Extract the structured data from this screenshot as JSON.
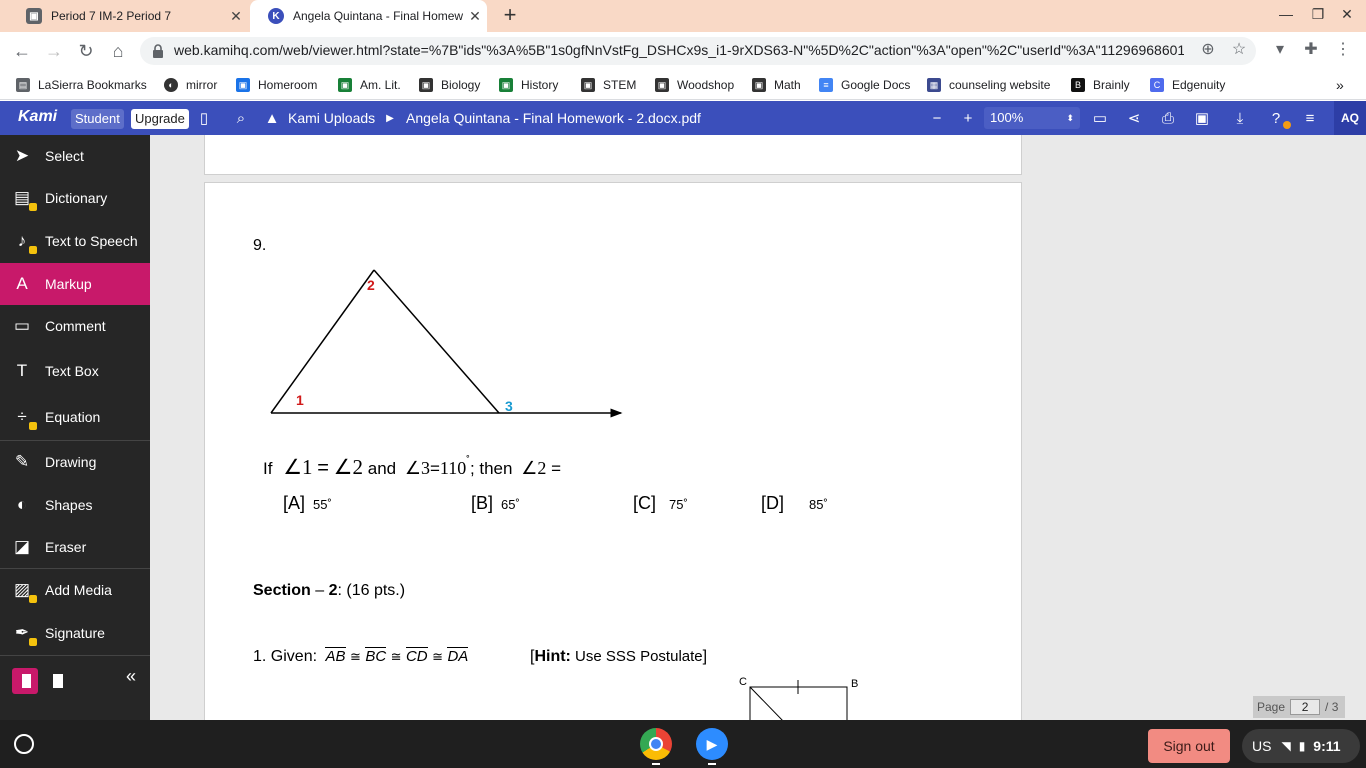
{
  "browser": {
    "tabs": [
      {
        "title": "Period 7 IM-2 Period 7",
        "active": false
      },
      {
        "title": "Angela Quintana - Final Homew",
        "active": true
      }
    ],
    "url": "web.kamihq.com/web/viewer.html?state=%7B\"ids\"%3A%5B\"1s0gfNnVstFg_DSHCx9s_i1-9rXDS63-N\"%5D%2C\"action\"%3A\"open\"%2C\"userId\"%3A\"1129696860122...",
    "bookmarks": [
      {
        "label": "LaSierra Bookmarks",
        "icon": "folder-icon"
      },
      {
        "label": "mirror",
        "icon": "globe-icon"
      },
      {
        "label": "Homeroom",
        "icon": "classroom-icon"
      },
      {
        "label": "Am. Lit.",
        "icon": "classroom-icon"
      },
      {
        "label": "Biology",
        "icon": "classroom-icon"
      },
      {
        "label": "History",
        "icon": "classroom-icon"
      },
      {
        "label": "STEM",
        "icon": "classroom-icon"
      },
      {
        "label": "Woodshop",
        "icon": "classroom-icon"
      },
      {
        "label": "Math",
        "icon": "classroom-icon"
      },
      {
        "label": "Google Docs",
        "icon": "docs-icon"
      },
      {
        "label": "counseling website",
        "icon": "site-icon"
      },
      {
        "label": "Brainly",
        "icon": "brainly-icon"
      },
      {
        "label": "Edgenuity",
        "icon": "edgenuity-icon"
      }
    ]
  },
  "kami": {
    "logo": "Kami",
    "student_badge": "Student",
    "upgrade_badge": "Upgrade",
    "breadcrumb_folder": "Kami Uploads",
    "breadcrumb_file": "Angela Quintana - Final Homework - 2.docx.pdf",
    "zoom": "100%",
    "avatar": "AQ",
    "tools": [
      {
        "label": "Select",
        "icon": "cursor-icon",
        "locked": false,
        "active": false
      },
      {
        "label": "Dictionary",
        "icon": "book-icon",
        "locked": true,
        "active": false
      },
      {
        "label": "Text to Speech",
        "icon": "speech-icon",
        "locked": true,
        "active": false
      },
      {
        "label": "Markup",
        "icon": "markup-icon",
        "locked": false,
        "active": true
      },
      {
        "label": "Comment",
        "icon": "comment-icon",
        "locked": false,
        "active": false
      },
      {
        "label": "Text Box",
        "icon": "text-icon",
        "locked": false,
        "active": false
      },
      {
        "label": "Equation",
        "icon": "divide-icon",
        "locked": true,
        "active": false
      },
      {
        "label": "Drawing",
        "icon": "brush-icon",
        "locked": false,
        "active": false
      },
      {
        "label": "Shapes",
        "icon": "shapes-icon",
        "locked": false,
        "active": false
      },
      {
        "label": "Eraser",
        "icon": "eraser-icon",
        "locked": false,
        "active": false
      },
      {
        "label": "Add Media",
        "icon": "media-icon",
        "locked": true,
        "active": false
      },
      {
        "label": "Signature",
        "icon": "pen-icon",
        "locked": true,
        "active": false
      }
    ],
    "page_label": "Page",
    "page_current": "2",
    "page_total": "/ 3",
    "accent_color": "#3b4fbb",
    "active_tool_color": "#c8196a"
  },
  "document": {
    "q9_number": "9.",
    "angle_labels": {
      "a1": "1",
      "a2": "2",
      "a3": "3"
    },
    "q9_if": "If",
    "q9_angle1": "∠1",
    "q9_eq1": "=",
    "q9_angle2": "∠2",
    "q9_and": "and",
    "q9_angle3": "∠3",
    "q9_eq2": "=",
    "q9_val": "110",
    "q9_deg": "˚",
    "q9_then": "; then",
    "q9_angle2b": "∠2",
    "q9_eq3": "=",
    "choices": [
      {
        "letter": "[A]",
        "value": "55˚"
      },
      {
        "letter": "[B]",
        "value": "65˚"
      },
      {
        "letter": "[C]",
        "value": "75˚"
      },
      {
        "letter": "[D]",
        "value": "85˚"
      }
    ],
    "section_bold": "Section",
    "section_dash": " – ",
    "section_num": "2",
    "section_pts": ": (16 pts.)",
    "given_prefix": "1. Given:",
    "given_segments": [
      "AB",
      "BC",
      "CD",
      "DA"
    ],
    "congruent_symbol": "≅",
    "hint_open": "[",
    "hint_label": "Hint:",
    "hint_text": " Use SSS Postulate",
    "hint_close": "]",
    "fig_c": "C",
    "fig_b": "B"
  },
  "system": {
    "signout": "Sign out",
    "locale": "US",
    "time": "9:11"
  }
}
